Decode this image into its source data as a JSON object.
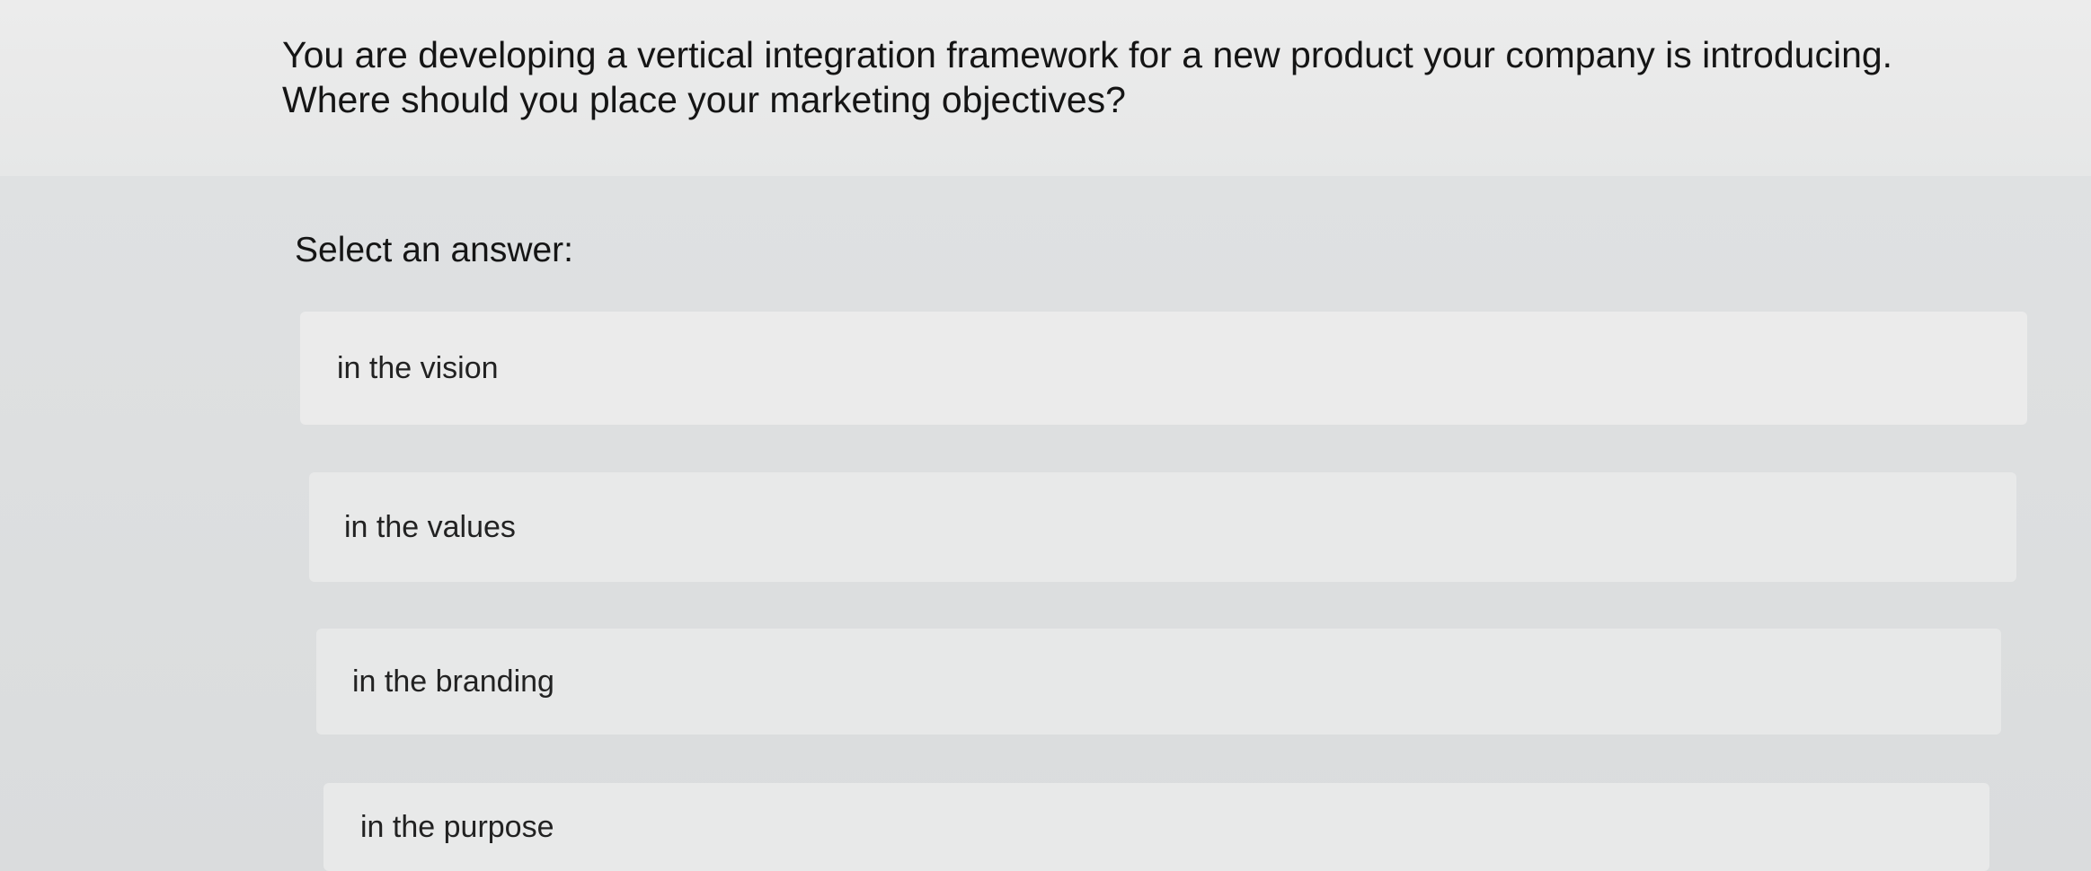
{
  "question": {
    "line_1": "You are developing a vertical integration framework for a new product your company is introducing.",
    "line_2": "Where should you place your marketing objectives?"
  },
  "prompt": {
    "label": "Select an answer:"
  },
  "options": [
    {
      "label": "in the vision"
    },
    {
      "label": "in the values"
    },
    {
      "label": "in the branding"
    },
    {
      "label": "in the purpose"
    }
  ],
  "colors": {
    "question_band": "#ececec",
    "answer_band": "#dfe1e2",
    "option_background": "#e9e9e9",
    "text": "#151515"
  }
}
